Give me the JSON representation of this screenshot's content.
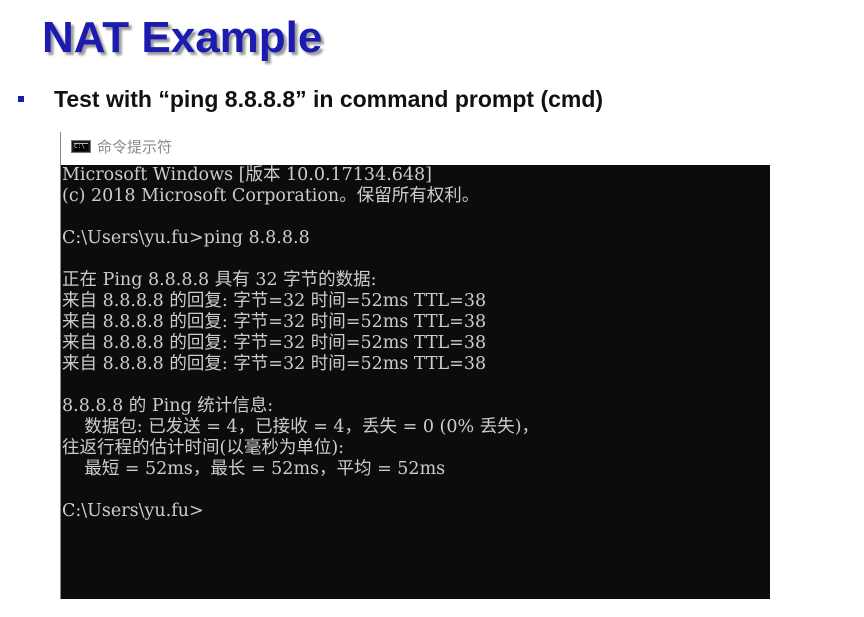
{
  "slide": {
    "title": "NAT Example",
    "bullet": "Test with “ping 8.8.8.8” in command prompt (cmd)"
  },
  "cmd_window": {
    "title": "命令提示符",
    "icon": "cmd-console-icon",
    "icon_text": "C:\\",
    "lines": [
      "Microsoft Windows [版本 10.0.17134.648]",
      "(c) 2018 Microsoft Corporation。保留所有权利。",
      "",
      "C:\\Users\\yu.fu>ping 8.8.8.8",
      "",
      "正在 Ping 8.8.8.8 具有 32 字节的数据:",
      "来自 8.8.8.8 的回复: 字节=32 时间=52ms TTL=38",
      "来自 8.8.8.8 的回复: 字节=32 时间=52ms TTL=38",
      "来自 8.8.8.8 的回复: 字节=32 时间=52ms TTL=38",
      "来自 8.8.8.8 的回复: 字节=32 时间=52ms TTL=38",
      "",
      "8.8.8.8 的 Ping 统计信息:",
      "    数据包: 已发送 = 4，已接收 = 4，丢失 = 0 (0% 丢失)，",
      "往返行程的估计时间(以毫秒为单位):",
      "    最短 = 52ms，最长 = 52ms，平均 = 52ms",
      "",
      "C:\\Users\\yu.fu>"
    ]
  },
  "colors": {
    "title": "#1b1bb0",
    "bullet_marker": "#1b1bb0",
    "console_bg": "#0c0c0c",
    "console_text": "#cccccc"
  }
}
